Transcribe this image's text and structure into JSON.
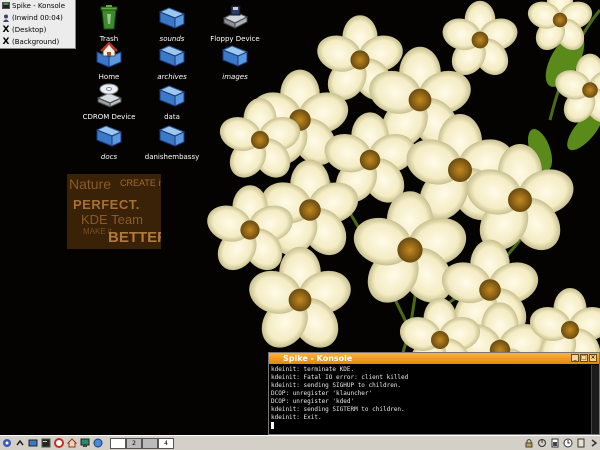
{
  "window_list": {
    "items": [
      {
        "label": "Spike - Konsole",
        "icon": "konsole-icon"
      },
      {
        "label": "(Inwind 00:04)",
        "icon": "user-icon"
      },
      {
        "label": "(Desktop)",
        "icon": "x-icon"
      },
      {
        "label": "(Background)",
        "icon": "x-icon"
      }
    ]
  },
  "desktop_icons": [
    {
      "label": "Trash",
      "icon": "trash-icon"
    },
    {
      "label": "sounds",
      "icon": "folder-icon"
    },
    {
      "label": "Floppy Device",
      "icon": "floppy-icon"
    },
    {
      "label": "Home",
      "icon": "home-folder-icon"
    },
    {
      "label": "archives",
      "icon": "folder-icon"
    },
    {
      "label": "images",
      "icon": "folder-icon"
    },
    {
      "label": "CDROM Device",
      "icon": "cdrom-icon"
    },
    {
      "label": "data",
      "icon": "folder-icon"
    },
    {
      "label": "docs",
      "icon": "folder-icon"
    },
    {
      "label": "danishembassy",
      "icon": "folder-icon"
    }
  ],
  "nature_box": {
    "line1": "Nature",
    "line2": "CREATE it",
    "line3": "PERFECT.",
    "line4": "KDE Team",
    "line5": "MAKE it",
    "line6": "BETTER."
  },
  "konsole": {
    "title": "Spike - Konsole",
    "lines": [
      "kdeinit: terminate KDE.",
      "kdeinit: Fatal IO error: client killed",
      "kdeinit: sending SIGHUP to children.",
      "DCOP: unregister 'klauncher'",
      "DCOP: unregister 'kded'",
      "kdeinit: sending SIGTERM to children.",
      "kdeinit: Exit."
    ]
  },
  "taskbar": {
    "pager": [
      "1",
      "2",
      "3",
      "4"
    ],
    "active_desktop": "1"
  },
  "colors": {
    "konsole_title": "#f0a020",
    "taskbar": "#d4d0c8",
    "nature_box": "#3a2208"
  }
}
